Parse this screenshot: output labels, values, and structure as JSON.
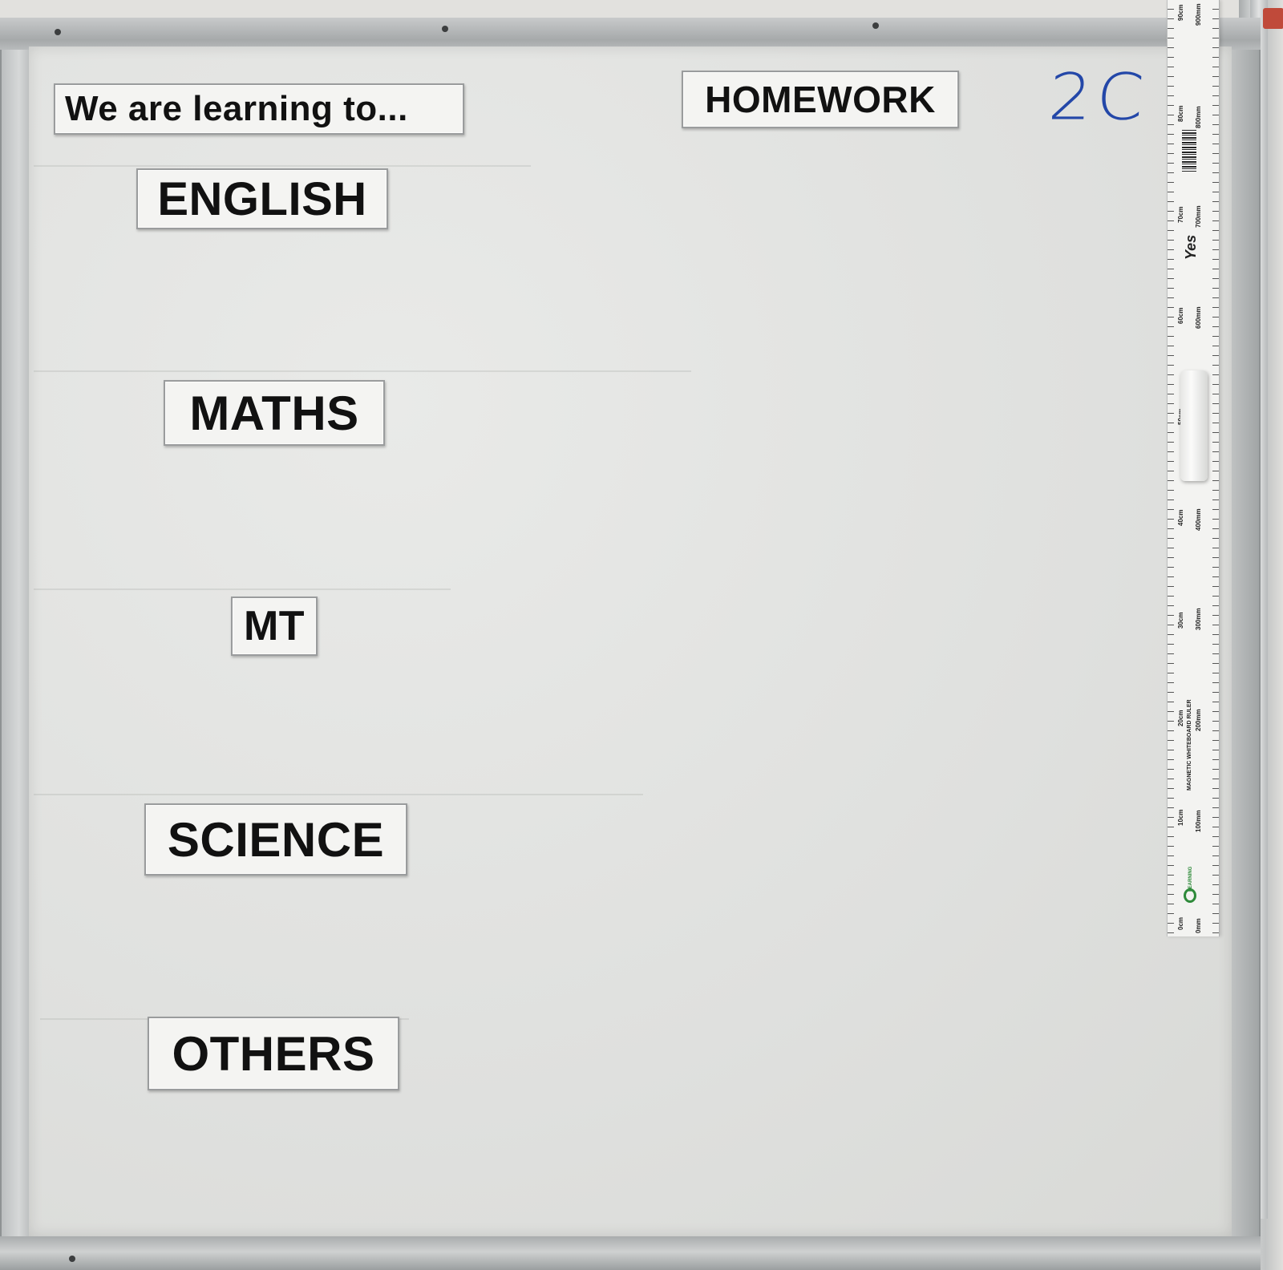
{
  "board": {
    "objective_heading": "We are learning to...",
    "homework_heading": "HOMEWORK",
    "class_label": "2C",
    "subjects": {
      "english": "ENGLISH",
      "maths": "MATHS",
      "mt": "MT",
      "science": "SCIENCE",
      "others": "OTHERS"
    }
  },
  "ruler": {
    "title": "MAGNETIC WHITEBOARD RULER",
    "brand": "LEARNING",
    "mark": "Yes",
    "cm_labels": [
      "0cm",
      "10cm",
      "20cm",
      "30cm",
      "40cm",
      "50cm",
      "60cm",
      "70cm",
      "80cm",
      "90cm"
    ],
    "mm_labels": [
      "0mm",
      "100mm",
      "200mm",
      "300mm",
      "400mm",
      "600mm",
      "700mm",
      "800mm",
      "900mm"
    ]
  },
  "colors": {
    "marker_blue": "#2347a8",
    "label_text": "#111111",
    "board_surface": "#e2e3e1",
    "frame_aluminium": "#b3b6b7",
    "ruler_logo_green": "#2e8a3a"
  }
}
